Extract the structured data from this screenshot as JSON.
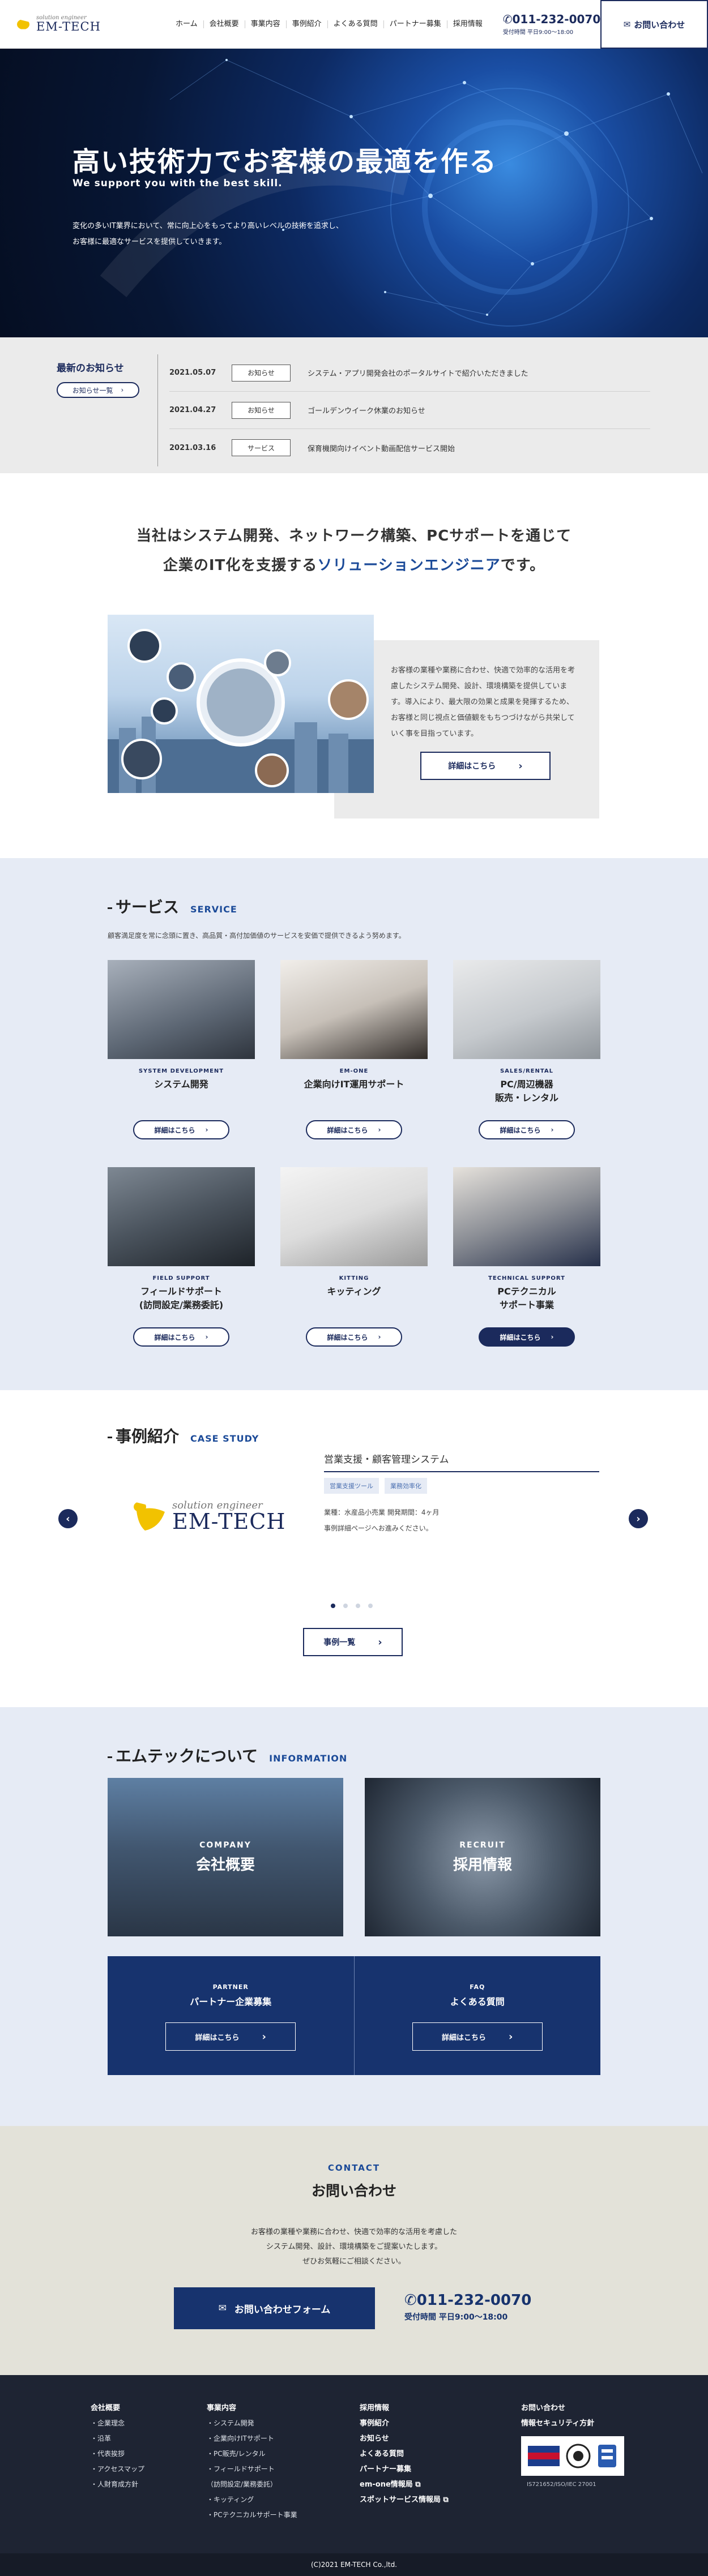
{
  "header": {
    "logo_sub": "solution engineer",
    "logo_main": "EM-TECH",
    "nav": [
      "ホーム",
      "会社概要",
      "事業内容",
      "事例紹介",
      "よくある質問",
      "パートナー募集",
      "採用情報"
    ],
    "tel": "011-232-0070",
    "tel_hours": "受付時間 平日9:00～18:00",
    "contact_label": "お問い合わせ"
  },
  "hero": {
    "title": "高い技術力でお客様の最適を作る",
    "subtitle": "We support you with the best skill.",
    "desc_line1": "変化の多いIT業界において、常に向上心をもってより高いレベルの技術を追求し、",
    "desc_line2": "お客様に最適なサービスを提供していきます。"
  },
  "news": {
    "title": "最新のお知らせ",
    "more": "お知らせ一覧",
    "items": [
      {
        "date": "2021.05.07",
        "tag": "お知らせ",
        "text": "システム・アプリ開発会社のポータルサイトで紹介いただきました"
      },
      {
        "date": "2021.04.27",
        "tag": "お知らせ",
        "text": "ゴールデンウイーク休業のお知らせ"
      },
      {
        "date": "2021.03.16",
        "tag": "サービス",
        "text": "保育機関向けイベント動画配信サービス開始"
      }
    ]
  },
  "intro": {
    "line1": "当社はシステム開発、ネットワーク構築、PCサポートを通じて",
    "line2_pre": "企業のIT化を支援する",
    "line2_hl": "ソリューションエンジニア",
    "line2_post": "です。",
    "text": "お客様の業種や業務に合わせ、快適で効率的な活用を考慮したシステム開発、設計、環境構築を提供しています。導入により、最大限の効果と成果を発揮するため、お客様と同じ視点と価値観をもちつづけながら共栄していく事を目指っています。",
    "btn": "詳細はこちら"
  },
  "service": {
    "title_jp": "サービス",
    "title_en": "SERVICE",
    "desc": "顧客満足度を常に念頭に置き、高品質・高付加価値のサービスを安価で提供できるよう努めます。",
    "btn": "詳細はこちら",
    "items": [
      {
        "en": "SYSTEM DEVELOPMENT",
        "jp": "システム開発"
      },
      {
        "en": "EM-ONE",
        "jp": "企業向けIT運用サポート"
      },
      {
        "en": "SALES/RENTAL",
        "jp": "PC/周辺機器\n販売・レンタル"
      },
      {
        "en": "FIELD SUPPORT",
        "jp": "フィールドサポート\n(訪問設定/業務委託)"
      },
      {
        "en": "KITTING",
        "jp": "キッティング"
      },
      {
        "en": "TECHNICAL SUPPORT",
        "jp": "PCテクニカル\nサポート事業"
      }
    ]
  },
  "case": {
    "title_jp": "事例紹介",
    "title_en": "CASE STUDY",
    "item_title": "営業支援・顧客管理システム",
    "tags": [
      "営業支援ツール",
      "業務効率化"
    ],
    "info1": "業種：水産品小売業 開発期間：4ヶ月",
    "info2": "事例詳細ページへお進みください。",
    "logo_sub": "solution engineer",
    "logo_main": "EM-TECH",
    "prev": "‹",
    "next": "›",
    "btn": "事例一覧"
  },
  "info": {
    "title_jp": "エムテックについて",
    "title_en": "INFORMATION",
    "company_en": "COMPANY",
    "company_jp": "会社概要",
    "recruit_en": "RECRUIT",
    "recruit_jp": "採用情報",
    "partner_en": "PARTNER",
    "partner_jp": "パートナー企業募集",
    "faq_en": "FAQ",
    "faq_jp": "よくある質問",
    "btn": "詳細はこちら"
  },
  "contact": {
    "en": "CONTACT",
    "jp": "お問い合わせ",
    "desc1": "お客様の業種や業務に合わせ、快適で効率的な活用を考慮した",
    "desc2": "システム開発、設計、環境構築をご提案いたします。",
    "desc3": "ぜひお気軽にご相談ください。",
    "btn": "お問い合わせフォーム",
    "tel": "011-232-0070",
    "hours": "受付時間 平日9:00～18:00"
  },
  "footer": {
    "col1_head": "会社概要",
    "col1": [
      "・企業理念",
      "・沿革",
      "・代表挨拶",
      "・アクセスマップ",
      "・人財育成方針"
    ],
    "col2_head": "事業内容",
    "col2": [
      "・システム開発",
      "・企業向けITサポート",
      "・PC販売/レンタル",
      "・フィールドサポート",
      "（訪問設定/業務委託）",
      "・キッティング",
      "・PCテクニカルサポート事業"
    ],
    "col3": [
      "採用情報",
      "事例紹介",
      "お知らせ",
      "よくある質問",
      "パートナー募集",
      "em-one情報局",
      "スポットサービス情報局"
    ],
    "col4": [
      "お問い合わせ",
      "情報セキュリティ方針"
    ],
    "cert_text": "IS721652/ISO/IEC 27001",
    "copyright": "(C)2021 EM-TECH Co.,ltd."
  }
}
